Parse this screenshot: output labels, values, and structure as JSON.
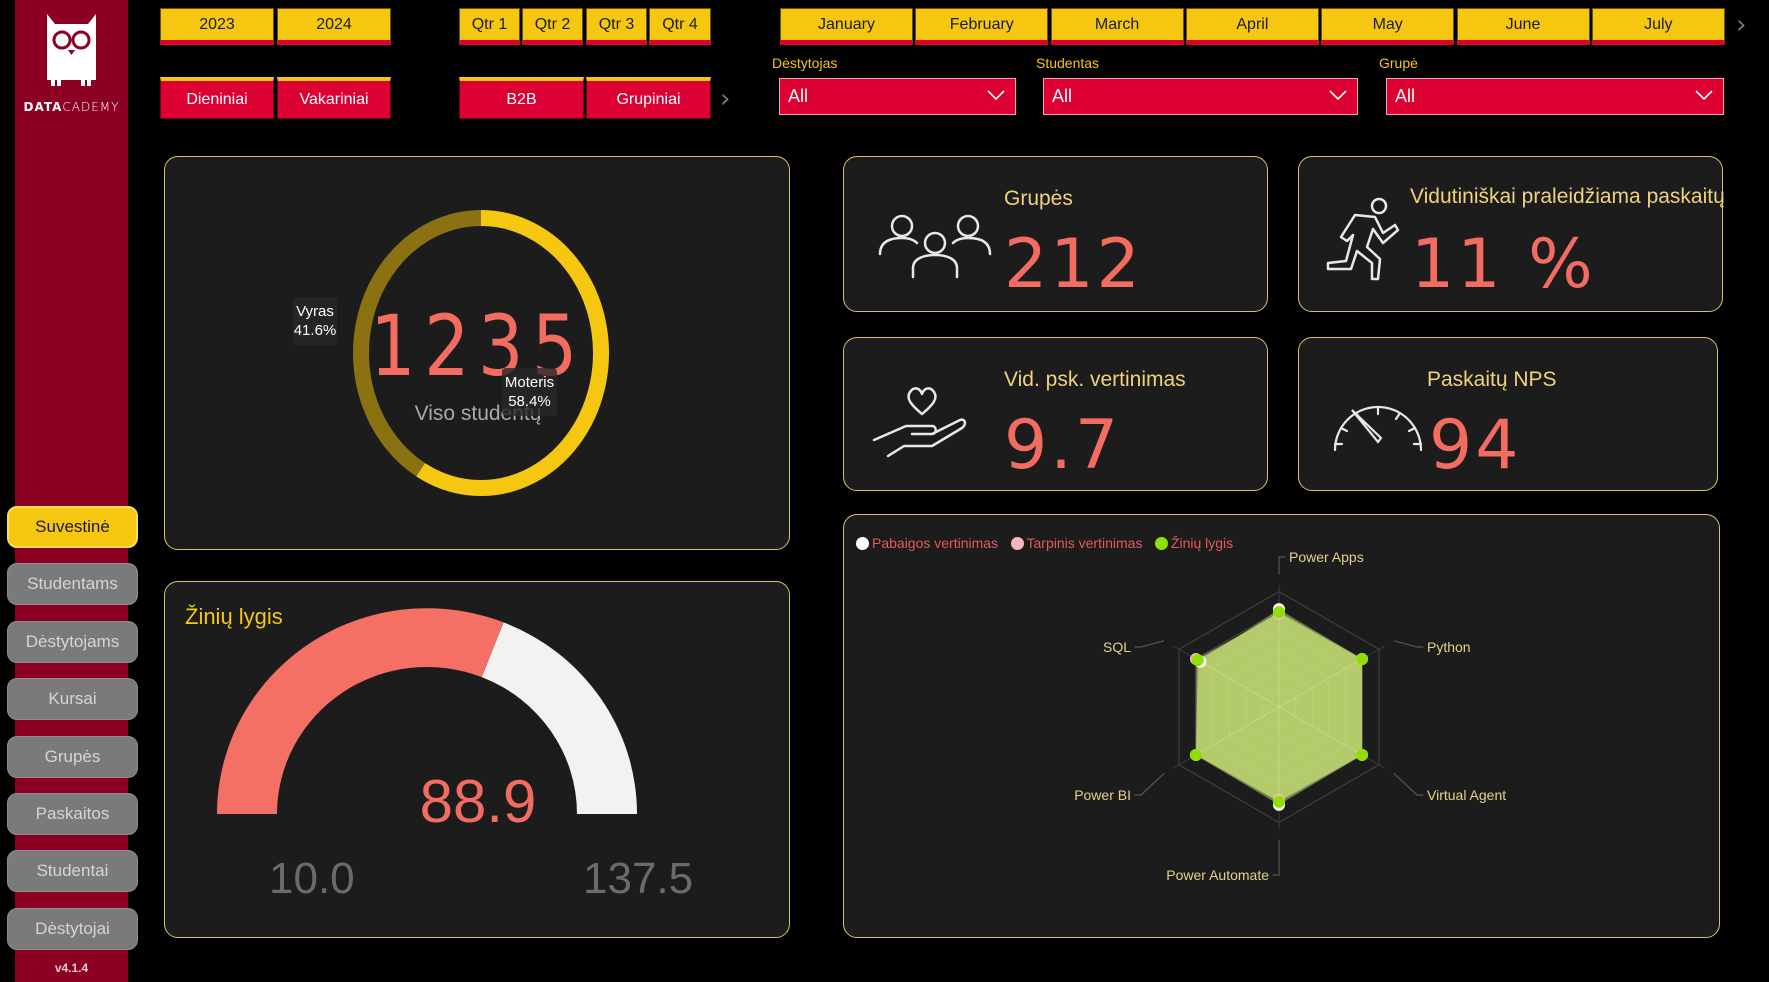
{
  "app": {
    "brand": {
      "bold": "DATA",
      "light": "CADEMY"
    },
    "version": "v4.1.4"
  },
  "sidebar": {
    "items": [
      {
        "label": "Suvestinė",
        "active": true
      },
      {
        "label": "Studentams",
        "active": false
      },
      {
        "label": "Dėstytojams",
        "active": false
      },
      {
        "label": "Kursai",
        "active": false
      },
      {
        "label": "Grupės",
        "active": false
      },
      {
        "label": "Paskaitos",
        "active": false
      },
      {
        "label": "Studentai",
        "active": false
      },
      {
        "label": "Dėstytojai",
        "active": false
      }
    ]
  },
  "slicers": {
    "years": [
      "2023",
      "2024"
    ],
    "session_types": [
      "Dieniniai",
      "Vakariniai"
    ],
    "quarters": [
      "Qtr 1",
      "Qtr 2",
      "Qtr 3",
      "Qtr 4"
    ],
    "group_types": [
      "B2B",
      "Grupiniai"
    ],
    "months": [
      "January",
      "February",
      "March",
      "April",
      "May",
      "June",
      "July"
    ],
    "icons": {
      "next": "chevron-right-icon",
      "dropdown": "chevron-down-icon"
    }
  },
  "filters": [
    {
      "label": "Dėstytojas",
      "value": "All"
    },
    {
      "label": "Studentas",
      "value": "All"
    },
    {
      "label": "Grupė",
      "value": "All"
    }
  ],
  "colors": {
    "sidebar": "#8c0023",
    "accent_yellow": "#f5c710",
    "accent_red": "#dc0033",
    "kpi_value": "#f36c62",
    "card_border": "#d8c06a",
    "card_bg": "#1c1c1c"
  },
  "donut": {
    "total": "1235",
    "subtitle": "Viso studentų",
    "segments": [
      {
        "label": "Vyras",
        "percent_label": "41.6%",
        "value": 41.6,
        "color": "#8a7212"
      },
      {
        "label": "Moteris",
        "percent_label": "58.4%",
        "value": 58.4,
        "color": "#f5c710"
      }
    ]
  },
  "kpis": [
    {
      "title": "Grupės",
      "value": "212",
      "icon": "people-group-icon"
    },
    {
      "title": "Vidutiniškai praleidžiama paskaitų",
      "value": "11 %",
      "icon": "running-person-icon"
    },
    {
      "title": "Vid. psk. vertinimas",
      "value": "9.7",
      "icon": "heart-in-hand-icon"
    },
    {
      "title": "Paskaitų NPS",
      "value": "94",
      "icon": "speedometer-icon"
    }
  ],
  "gauge": {
    "title": "Žinių lygis",
    "value": 88.9,
    "value_label": "88.9",
    "min": 10.0,
    "min_label": "10.0",
    "max": 137.5,
    "max_label": "137.5",
    "fill_color": "#f46f64",
    "track_color": "#f3f2f1"
  },
  "chart_data": {
    "type": "radar",
    "title": "",
    "categories": [
      "Power Apps",
      "Python",
      "Virtual Agent",
      "Power Automate",
      "Power BI",
      "SQL"
    ],
    "legend": [
      "Pabaigos vertinimas",
      "Tarpinis vertinimas",
      "Žinių lygis"
    ],
    "legend_position": "top-left",
    "series": [
      {
        "name": "Pabaigos vertinimas",
        "color": "#ffffff",
        "values": [
          9.6,
          9.4,
          9.4,
          9.6,
          9.4,
          8.9
        ]
      },
      {
        "name": "Tarpinis vertinimas",
        "color": "#f4b8b8",
        "values": [
          9.1,
          9.4,
          9.4,
          9.1,
          9.4,
          9.4
        ]
      },
      {
        "name": "Žinių lygis",
        "color": "#8fe000",
        "values": [
          9.3,
          9.4,
          9.4,
          9.3,
          9.4,
          9.2
        ]
      }
    ],
    "range": [
      0,
      10
    ]
  }
}
